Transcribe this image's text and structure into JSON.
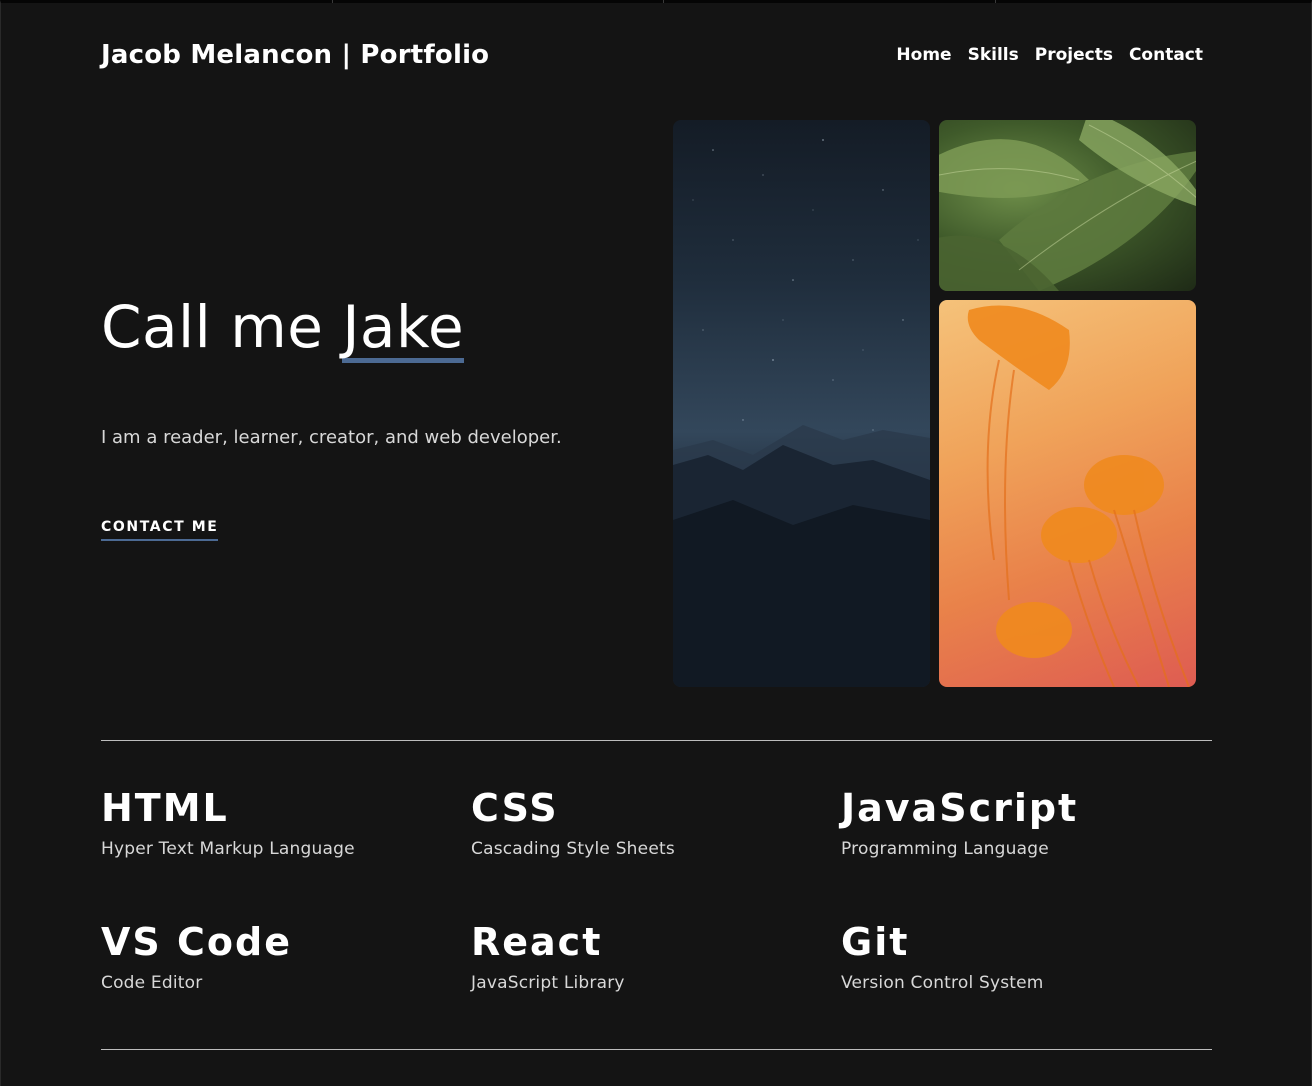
{
  "header": {
    "brand": "Jacob Melancon | Portfolio",
    "nav": [
      {
        "label": "Home"
      },
      {
        "label": "Skills"
      },
      {
        "label": "Projects"
      },
      {
        "label": "Contact"
      }
    ]
  },
  "hero": {
    "title_prefix": "Call me ",
    "title_accent": "Jake",
    "subtitle": "I am a reader, learner, creator, and web developer.",
    "cta_label": "CONTACT ME"
  },
  "skills": [
    {
      "name": "HTML",
      "desc": "Hyper Text Markup Language"
    },
    {
      "name": "CSS",
      "desc": "Cascading Style Sheets"
    },
    {
      "name": "JavaScript",
      "desc": "Programming Language"
    },
    {
      "name": "VS Code",
      "desc": "Code Editor"
    },
    {
      "name": "React",
      "desc": "JavaScript Library"
    },
    {
      "name": "Git",
      "desc": "Version Control System"
    }
  ],
  "colors": {
    "background": "#141414",
    "accent": "#4c6a93",
    "text": "#ffffff",
    "muted_text": "#d8d8d8"
  }
}
